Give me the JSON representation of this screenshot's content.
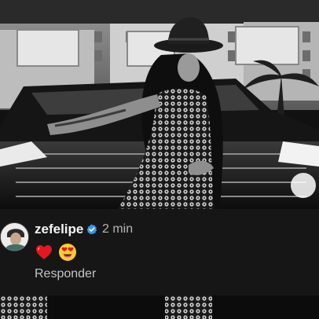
{
  "comment": {
    "username": "zefelipe",
    "verified": true,
    "timestamp": "2 min",
    "reactions": [
      "heart-emoji",
      "heart-eyes-emoji"
    ],
    "reply_label": "Responder"
  },
  "colors": {
    "card_background": "#161616",
    "username_text": "#f5f5f5",
    "secondary_text": "#b5b5b5",
    "verified_badge": "#3897f0",
    "heart": "#e0181f",
    "emoji_face": "#ffcc33"
  }
}
